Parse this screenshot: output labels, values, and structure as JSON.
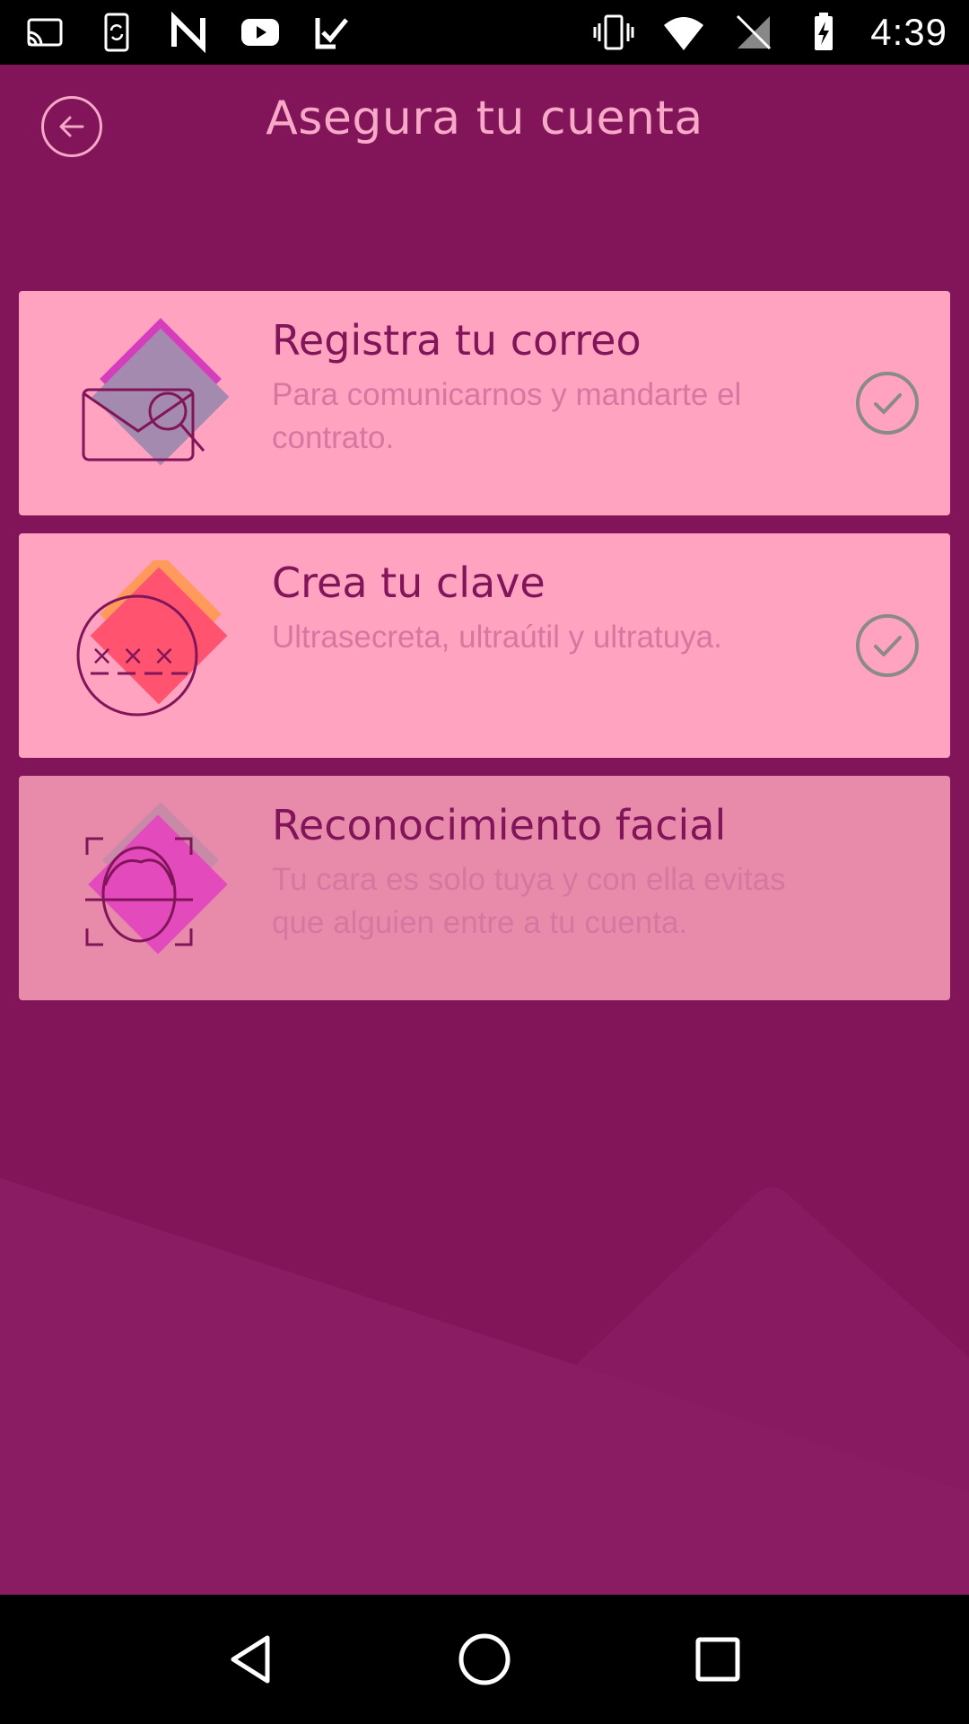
{
  "status_bar": {
    "time": "4:39",
    "icons_left": [
      "cast-icon",
      "sync-phone-icon",
      "n-logo-icon",
      "youtube-icon",
      "check-app-icon"
    ],
    "icons_right": [
      "vibrate-icon",
      "wifi-icon",
      "no-signal-icon",
      "battery-charging-icon"
    ]
  },
  "header": {
    "title": "Asegura tu cuenta",
    "back_icon": "back-arrow-icon"
  },
  "steps": [
    {
      "title": "Registra tu correo",
      "description": "Para comunicarnos y mandarte el contrato.",
      "icon": "email-search-icon",
      "completed": true
    },
    {
      "title": "Crea tu clave",
      "description": "Ultrasecreta, ultraútil y ultratuya.",
      "icon": "password-icon",
      "completed": true
    },
    {
      "title": "Reconocimiento facial",
      "description": "Tu cara es solo tuya y con ella evitas que alguien entre a tu cuenta.",
      "icon": "face-recognition-icon",
      "completed": false
    }
  ],
  "nav_bar": {
    "buttons": [
      "back-triangle-icon",
      "home-circle-icon",
      "recents-square-icon"
    ]
  },
  "colors": {
    "background": "#82155a",
    "card": "#ffa3c1",
    "card_disabled": "#e88bab",
    "title_text": "#82155a",
    "desc_text": "#d577a0",
    "header_text": "#f9a9c8",
    "check": "#8a8a8a"
  }
}
